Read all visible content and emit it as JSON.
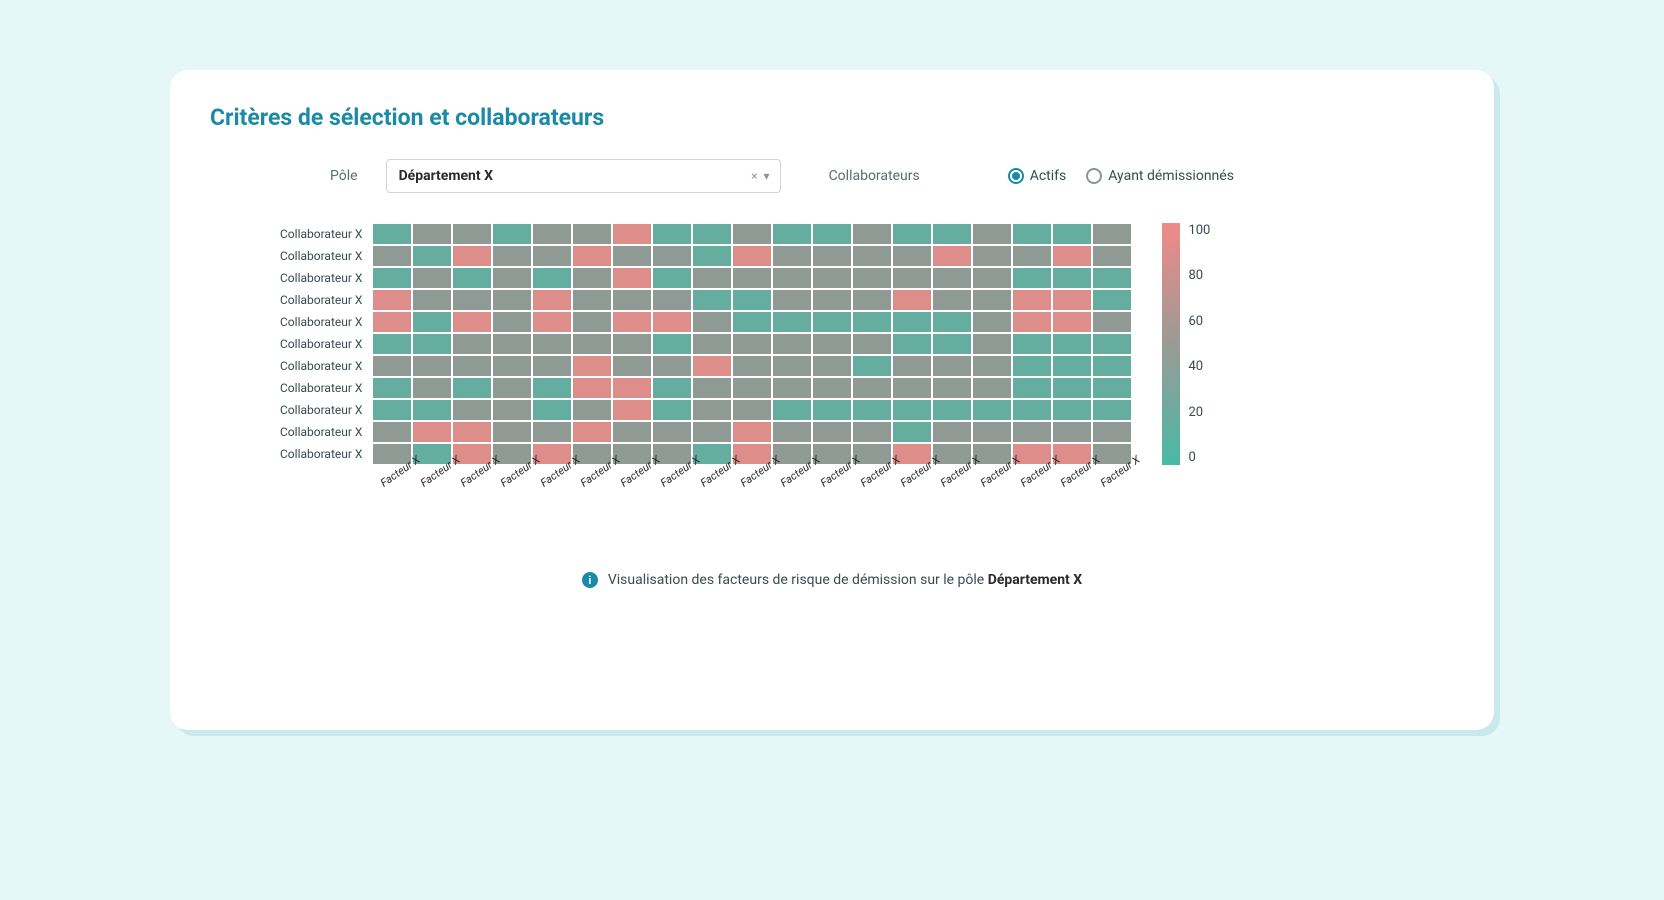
{
  "title": "Critères de sélection et collaborateurs",
  "controls": {
    "pole_label": "Pôle",
    "selected_pole": "Département X",
    "collab_label": "Collaborateurs",
    "radio_active": "Actifs",
    "radio_resigned": "Ayant démissionnés",
    "selected_radio": "Actifs"
  },
  "footer": {
    "text_prefix": "Visualisation des facteurs de risque de démission sur le pôle",
    "pole": "Département X"
  },
  "legend_ticks": [
    "100",
    "80",
    "60",
    "40",
    "20",
    "0"
  ],
  "colors": {
    "low": "#49b9a5",
    "mid": "#8f9a95",
    "high": "#f08a87"
  },
  "chart_data": {
    "type": "heatmap",
    "title": "",
    "xlabel": "",
    "ylabel": "",
    "zlim": [
      0,
      100
    ],
    "rows": [
      "Collaborateur X",
      "Collaborateur X",
      "Collaborateur X",
      "Collaborateur X",
      "Collaborateur X",
      "Collaborateur X",
      "Collaborateur X",
      "Collaborateur X",
      "Collaborateur X",
      "Collaborateur X",
      "Collaborateur X"
    ],
    "columns": [
      "Facteur X",
      "Facteur X",
      "Facteur X",
      "Facteur X",
      "Facteur X",
      "Facteur X",
      "Facteur X",
      "Facteur X",
      "Facteur X",
      "Facteur X",
      "Facteur X",
      "Facteur X",
      "Facteur X",
      "Facteur X",
      "Facteur X",
      "Facteur X",
      "Facteur X",
      "Facteur X",
      "Facteur X"
    ],
    "values": [
      [
        20,
        50,
        50,
        20,
        50,
        50,
        90,
        20,
        20,
        50,
        20,
        20,
        50,
        20,
        20,
        50,
        20,
        20,
        50
      ],
      [
        50,
        20,
        90,
        50,
        50,
        90,
        50,
        50,
        20,
        90,
        50,
        50,
        50,
        50,
        90,
        50,
        50,
        90,
        50
      ],
      [
        20,
        50,
        20,
        50,
        20,
        50,
        90,
        20,
        50,
        50,
        50,
        50,
        50,
        50,
        50,
        50,
        20,
        20,
        20
      ],
      [
        90,
        50,
        50,
        50,
        90,
        50,
        50,
        50,
        20,
        20,
        50,
        50,
        50,
        90,
        50,
        50,
        90,
        90,
        20
      ],
      [
        90,
        20,
        90,
        50,
        90,
        50,
        90,
        90,
        50,
        20,
        20,
        20,
        20,
        20,
        20,
        50,
        90,
        90,
        50
      ],
      [
        20,
        20,
        50,
        50,
        50,
        50,
        50,
        20,
        50,
        50,
        50,
        50,
        50,
        20,
        20,
        50,
        20,
        20,
        20
      ],
      [
        50,
        50,
        50,
        50,
        50,
        90,
        50,
        50,
        90,
        50,
        50,
        50,
        20,
        50,
        50,
        50,
        20,
        20,
        20
      ],
      [
        20,
        50,
        20,
        50,
        20,
        90,
        90,
        20,
        50,
        50,
        50,
        50,
        50,
        50,
        50,
        50,
        20,
        20,
        20
      ],
      [
        20,
        20,
        50,
        50,
        20,
        50,
        90,
        20,
        50,
        50,
        20,
        20,
        20,
        20,
        20,
        20,
        20,
        20,
        20
      ],
      [
        50,
        90,
        90,
        50,
        50,
        90,
        50,
        50,
        50,
        90,
        50,
        50,
        50,
        20,
        50,
        50,
        50,
        50,
        50
      ],
      [
        50,
        20,
        90,
        50,
        90,
        50,
        50,
        50,
        20,
        90,
        50,
        50,
        50,
        90,
        50,
        50,
        90,
        90,
        50
      ]
    ]
  }
}
